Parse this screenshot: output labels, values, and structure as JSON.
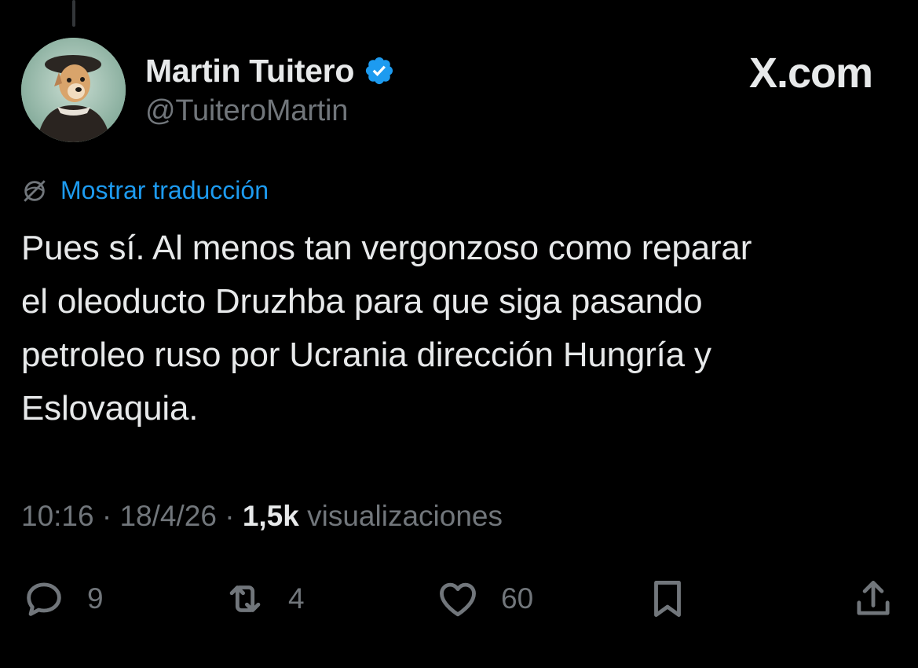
{
  "author": {
    "display_name": "Martin Tuitero",
    "handle": "@TuiteroMartin",
    "verified": true
  },
  "brand": {
    "domain": "X.com"
  },
  "translate": {
    "label": "Mostrar traducción"
  },
  "tweet": {
    "text": "Pues sí. Al menos tan vergonzoso como reparar\nel oleoducto Druzhba para que siga pasando\npetroleo ruso por Ucrania dirección Hungría y\nEslovaquia."
  },
  "meta": {
    "time": "10:16",
    "separator": " · ",
    "date": "18/4/26",
    "views_count": "1,5k",
    "views_label": "visualizaciones"
  },
  "actions": {
    "replies": "9",
    "reposts": "4",
    "likes": "60"
  },
  "colors": {
    "background": "#000000",
    "text_primary": "#e7e9ea",
    "text_secondary": "#71767b",
    "accent": "#1d9bf0"
  },
  "icons": {
    "reply": "reply-icon",
    "repost": "repost-icon",
    "like": "heart-icon",
    "bookmark": "bookmark-icon",
    "share": "share-icon",
    "translate": "globe-slash-icon",
    "verified": "verified-badge-icon"
  }
}
